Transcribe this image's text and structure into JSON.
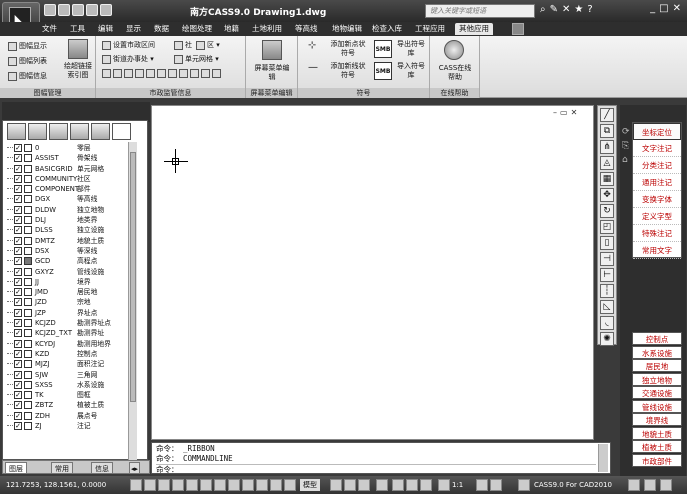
{
  "app": {
    "title": "南方CASS9.0    Drawing1.dwg",
    "app_icon": "cass-logo-icon",
    "search_placeholder": "键入关键字或短语",
    "title_icons": [
      "binoculars-icon",
      "wrench-icon",
      "x-icon",
      "star-icon",
      "help-icon"
    ],
    "window_controls": [
      "minimize-icon",
      "restore-icon",
      "close-icon"
    ]
  },
  "menu": {
    "items": [
      "文件",
      "工具",
      "编辑",
      "显示",
      "数据",
      "绘图处理",
      "地籍",
      "土地利用",
      "等高线",
      "地物编辑",
      "检查入库",
      "工程应用",
      "其他应用"
    ],
    "active": "其他应用"
  },
  "ribbon": {
    "panels": [
      {
        "label": "图幅管理",
        "items": [
          "图幅显示",
          "图幅列表",
          "图幅信息",
          "绘超链接索引图"
        ]
      },
      {
        "label": "市政监管信息",
        "items": [
          "设置市政区间",
          "社",
          "区",
          "街道办事处",
          "单元网格"
        ]
      },
      {
        "label": "屏幕菜单编辑",
        "items": [
          "屏幕菜单编辑"
        ]
      },
      {
        "label": "符号",
        "items": [
          "添加新点状符号",
          "添加新线状符号",
          "导出符号库",
          "导入符号库"
        ]
      },
      {
        "label": "在线帮助",
        "items": [
          "CASS在线帮助"
        ]
      }
    ],
    "symbol_badge": "SMB"
  },
  "layers": [
    {
      "name": "0",
      "desc": "零层",
      "color": "#ffffff"
    },
    {
      "name": "ASSIST",
      "desc": "骨架线",
      "color": "#ffffff"
    },
    {
      "name": "BASICGRID",
      "desc": "单元网格",
      "color": "#ffffff"
    },
    {
      "name": "COMMUNITY",
      "desc": "社区",
      "color": "#ffffff"
    },
    {
      "name": "COMPONENT",
      "desc": "部件",
      "color": "#ffffff"
    },
    {
      "name": "DGX",
      "desc": "等高线",
      "color": "#ffffff"
    },
    {
      "name": "DLDW",
      "desc": "独立地物",
      "color": "#ffffff"
    },
    {
      "name": "DLJ",
      "desc": "地类界",
      "color": "#ffffff"
    },
    {
      "name": "DLSS",
      "desc": "独立设施",
      "color": "#ffffff"
    },
    {
      "name": "DMTZ",
      "desc": "地貌土质",
      "color": "#ffffff"
    },
    {
      "name": "DSX",
      "desc": "等深线",
      "color": "#ffffff"
    },
    {
      "name": "GCD",
      "desc": "高程点",
      "color": "#777777"
    },
    {
      "name": "GXYZ",
      "desc": "管线设施",
      "color": "#ffffff"
    },
    {
      "name": "JJ",
      "desc": "境界",
      "color": "#ffffff"
    },
    {
      "name": "JMD",
      "desc": "居民地",
      "color": "#ffffff"
    },
    {
      "name": "JZD",
      "desc": "宗地",
      "color": "#ffffff"
    },
    {
      "name": "JZP",
      "desc": "界址点",
      "color": "#ffffff"
    },
    {
      "name": "KCJZD",
      "desc": "勘测界址点",
      "color": "#ffffff"
    },
    {
      "name": "KCJZD_TXT",
      "desc": "勘测界址",
      "color": "#ffffff"
    },
    {
      "name": "KCYDJ",
      "desc": "勘测用地界",
      "color": "#ffffff"
    },
    {
      "name": "KZD",
      "desc": "控制点",
      "color": "#ffffff"
    },
    {
      "name": "MJZJ",
      "desc": "面积注记",
      "color": "#ffffff"
    },
    {
      "name": "SJW",
      "desc": "三角网",
      "color": "#ffffff"
    },
    {
      "name": "SXSS",
      "desc": "水系设施",
      "color": "#ffffff"
    },
    {
      "name": "TK",
      "desc": "图框",
      "color": "#ffffff"
    },
    {
      "name": "ZBTZ",
      "desc": "植被土质",
      "color": "#ffffff"
    },
    {
      "name": "ZDH",
      "desc": "展点号",
      "color": "#ffffff"
    },
    {
      "name": "ZJ",
      "desc": "注记",
      "color": "#ffffff"
    }
  ],
  "left_tabs": [
    "图层",
    "常用",
    "信息"
  ],
  "right_panel": {
    "tabs": [
      "坐标定位",
      "文字注记",
      "分类注记",
      "通用注记",
      "变换字体",
      "定义字型",
      "特殊注记",
      "常用文字"
    ],
    "selected": "坐标定位",
    "categories": [
      "控制点",
      "水系设施",
      "居民地",
      "独立地物",
      "交通设施",
      "管线设施",
      "境界线",
      "地貌土质",
      "植被土质",
      "市政部件"
    ]
  },
  "command": {
    "lines": [
      "命令： _RIBBON",
      "命令： COMMANDLINE",
      "命令："
    ]
  },
  "status": {
    "coords": "121.7253, 128.1561, 0.0000",
    "model_label": "模型",
    "scale": "1:1",
    "version": "CASS9.0 For CAD2010"
  }
}
